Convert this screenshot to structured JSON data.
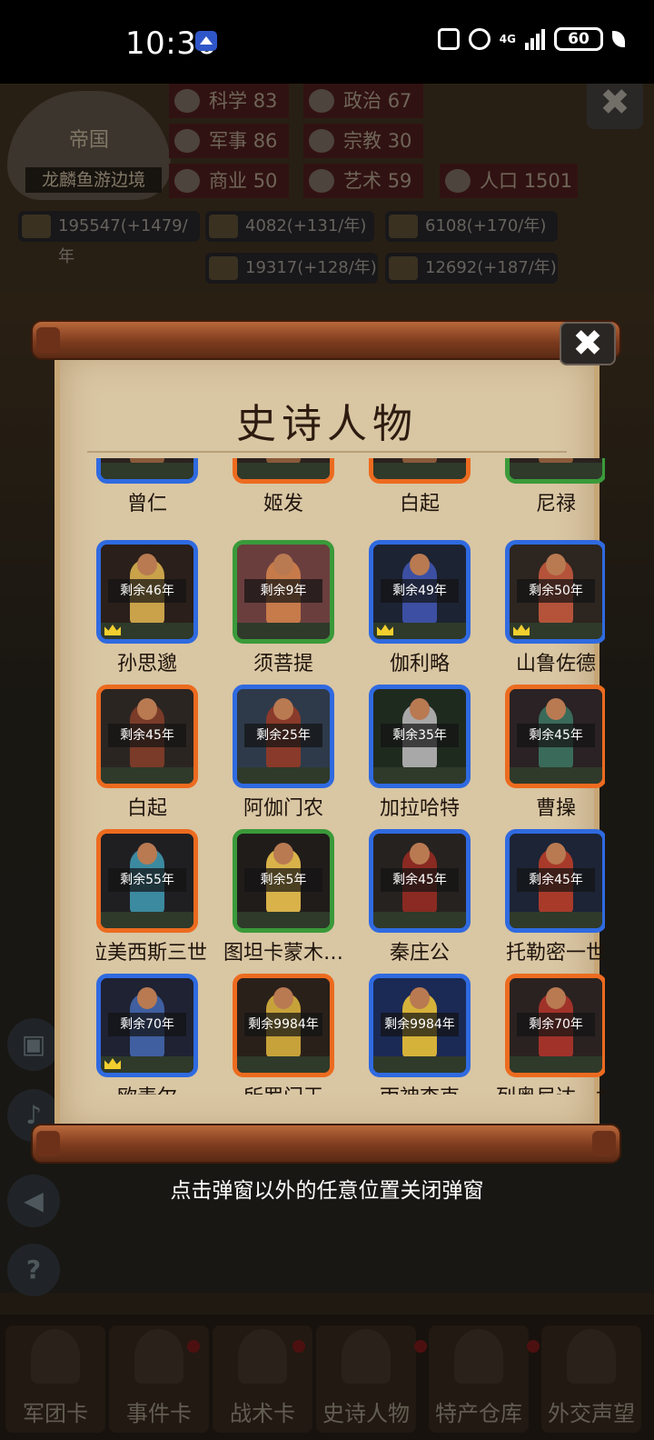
{
  "status_bar": {
    "time": "10:36",
    "network": "4G",
    "battery": "60"
  },
  "background": {
    "empire_title": "帝国",
    "empire_name": "龙麟鱼游边境",
    "stats": [
      {
        "label": "科学",
        "value": "83"
      },
      {
        "label": "政治",
        "value": "67"
      },
      {
        "label": "军事",
        "value": "86"
      },
      {
        "label": "宗教",
        "value": "30"
      },
      {
        "label": "商业",
        "value": "50"
      },
      {
        "label": "艺术",
        "value": "59"
      },
      {
        "label": "人口",
        "value": "1501"
      }
    ],
    "resources": [
      "195547(+1479/年",
      "4082(+131/年)",
      "6108(+170/年)",
      "19317(+128/年)",
      "12692(+187/年)"
    ],
    "nav": [
      "军团卡",
      "事件卡",
      "战术卡",
      "史诗人物",
      "特产仓库",
      "外交声望"
    ]
  },
  "popup": {
    "title": "史诗人物",
    "close": "✖",
    "partial_row": [
      {
        "name": "曾仁",
        "frame": "blue"
      },
      {
        "name": "姬发",
        "frame": "orange"
      },
      {
        "name": "白起",
        "frame": "orange"
      },
      {
        "name": "尼禄",
        "frame": "green"
      }
    ],
    "characters": [
      {
        "name": "孙思邈",
        "remain": "剩余46年",
        "frame": "blue",
        "crown": true,
        "bg": "#2a1f1a",
        "robe": "#c9a24a"
      },
      {
        "name": "须菩提",
        "remain": "剩余9年",
        "frame": "green",
        "crown": false,
        "bg": "#6b3e3e",
        "robe": "#c77a4a"
      },
      {
        "name": "伽利略",
        "remain": "剩余49年",
        "frame": "blue",
        "crown": true,
        "bg": "#1c2333",
        "robe": "#3c4fa3"
      },
      {
        "name": "山鲁佐德",
        "remain": "剩余50年",
        "frame": "blue",
        "crown": true,
        "bg": "#2d2520",
        "robe": "#b4533a"
      },
      {
        "name": "白起",
        "remain": "剩余45年",
        "frame": "orange",
        "crown": false,
        "bg": "#2b2522",
        "robe": "#7a3b28"
      },
      {
        "name": "阿伽门农",
        "remain": "剩余25年",
        "frame": "blue",
        "crown": false,
        "bg": "#2e3a4a",
        "robe": "#8a3a2a"
      },
      {
        "name": "加拉哈特",
        "remain": "剩余35年",
        "frame": "blue",
        "crown": false,
        "bg": "#1f2a1f",
        "robe": "#a8a8a8"
      },
      {
        "name": "曹操",
        "remain": "剩余45年",
        "frame": "orange",
        "crown": false,
        "bg": "#2a2224",
        "robe": "#3a6a5a"
      },
      {
        "name": "拉美西斯三世",
        "remain": "剩余55年",
        "frame": "orange",
        "crown": false,
        "bg": "#1f1f22",
        "robe": "#3c8aa0"
      },
      {
        "name": "图坦卡蒙木…",
        "remain": "剩余5年",
        "frame": "green",
        "crown": false,
        "bg": "#201c1a",
        "robe": "#d9b24a"
      },
      {
        "name": "秦庄公",
        "remain": "剩余45年",
        "frame": "blue",
        "crown": false,
        "bg": "#26221f",
        "robe": "#8a2a22"
      },
      {
        "name": "托勒密一世",
        "remain": "剩余45年",
        "frame": "blue",
        "crown": false,
        "bg": "#1c2436",
        "robe": "#a83a2a"
      },
      {
        "name": "欧麦尔",
        "remain": "剩余70年",
        "frame": "blue",
        "crown": true,
        "bg": "#1f2233",
        "robe": "#3f5fa0"
      },
      {
        "name": "所罗门王",
        "remain": "剩余9984年",
        "frame": "orange",
        "crown": false,
        "bg": "#2a201a",
        "robe": "#c7a23a"
      },
      {
        "name": "雨神查克",
        "remain": "剩余9984年",
        "frame": "blue",
        "crown": false,
        "bg": "#1a2a55",
        "robe": "#d5b23a"
      },
      {
        "name": "列奥尼达一世",
        "remain": "剩余70年",
        "frame": "orange",
        "crown": false,
        "bg": "#2a2220",
        "robe": "#a0322a"
      }
    ],
    "hint": "点击弹窗以外的任意位置关闭弹窗"
  }
}
